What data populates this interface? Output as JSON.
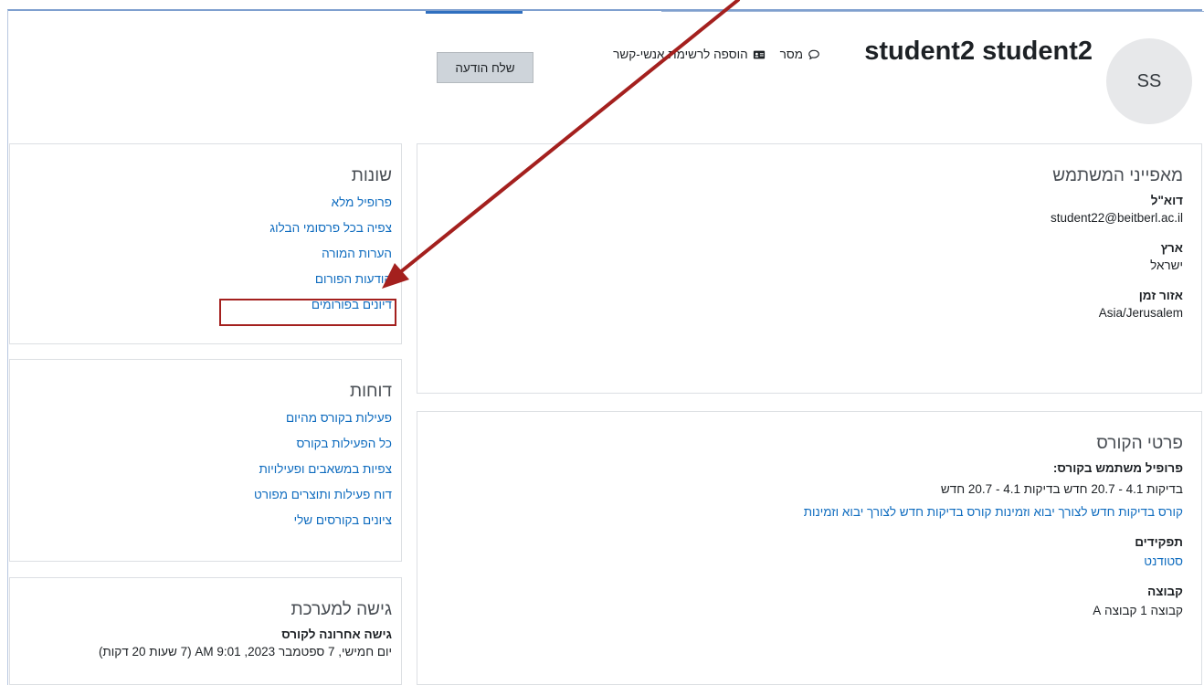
{
  "header": {
    "avatar_initials": "SS",
    "full_name": "student2 student2",
    "message_link": "מסר",
    "add_contact_link": "הוספה לרשימת אנשי-קשר",
    "send_message_button": "שלח הודעה"
  },
  "user_details": {
    "title": "מאפייני המשתמש",
    "email_label": "דוא\"ל",
    "email_value": "student22@beitberl.ac.il",
    "country_label": "ארץ",
    "country_value": "ישראל",
    "timezone_label": "אזור זמן",
    "timezone_value": "Asia/Jerusalem"
  },
  "course_details": {
    "title": "פרטי הקורס",
    "profile_label": "פרופיל משתמש בקורס:",
    "profile_value": "בדיקות 4.1 - 20.7 חדש בדיקות 4.1 - 20.7 חדש",
    "course_link": "קורס בדיקות חדש לצורך יבוא וזמינות קורס בדיקות חדש לצורך יבוא וזמינות",
    "roles_label": "תפקידים",
    "roles_value": "סטודנט",
    "group_label": "קבוצה",
    "group_value": "קבוצה 1 קבוצה A"
  },
  "misc": {
    "title": "שונות",
    "links": [
      "פרופיל מלא",
      "צפיה בכל פרסומי הבלוג",
      "הערות המורה",
      "הודעות הפורום",
      "דיונים בפורומים"
    ]
  },
  "reports": {
    "title": "דוחות",
    "links": [
      "פעילות בקורס מהיום",
      "כל הפעילות בקורס",
      "צפיות במשאבים ופעילויות",
      "דוח פעילות ותוצרים מפורט",
      "ציונים בקורסים שלי"
    ]
  },
  "access": {
    "title": "גישה למערכת",
    "last_access_label": "גישה אחרונה לקורס",
    "last_access_value": "יום חמישי, 7 ספטמבר 2023, 9:01 AM  (7 שעות 20 דקות)"
  },
  "annotation": {
    "color": "#a4201e"
  }
}
